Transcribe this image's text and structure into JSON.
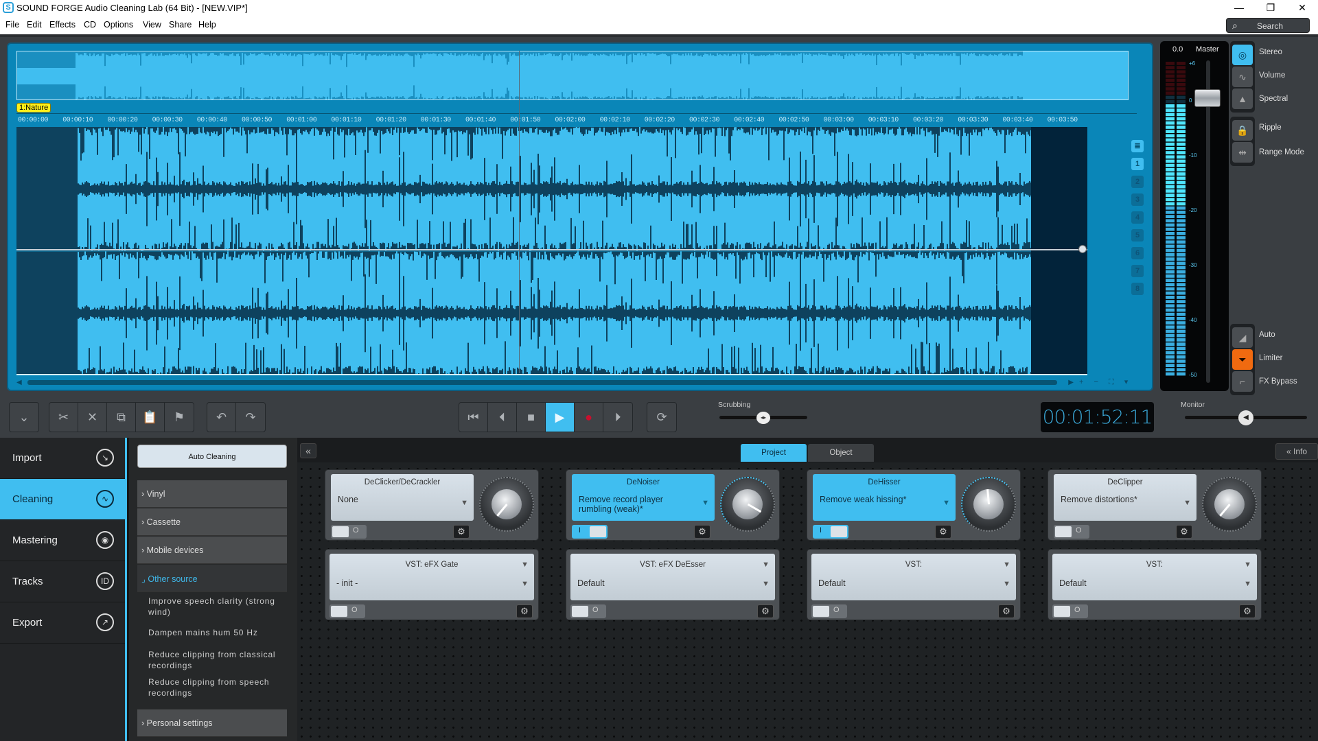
{
  "window": {
    "title": "SOUND FORGE Audio Cleaning Lab (64 Bit) - [NEW.VIP*]",
    "app_icon": "S",
    "minimize_glyph": "—",
    "restore_glyph": "❐",
    "close_glyph": "✕"
  },
  "menu": [
    "File",
    "Edit",
    "Effects",
    "CD",
    "Options",
    "View",
    "Share",
    "Help"
  ],
  "search": {
    "label": "Search",
    "icon": "magnifier-icon"
  },
  "waveform": {
    "marker_label": "1:Nature",
    "ruler_ticks": [
      "00:00:00",
      "00:00:10",
      "00:00:20",
      "00:00:30",
      "00:00:40",
      "00:00:50",
      "00:01:00",
      "00:01:10",
      "00:01:20",
      "00:01:30",
      "00:01:40",
      "00:01:50",
      "00:02:00",
      "00:02:10",
      "00:02:20",
      "00:02:30",
      "00:02:40",
      "00:02:50",
      "00:03:00",
      "00:03:10",
      "00:03:20",
      "00:03:30",
      "00:03:40",
      "00:03:50"
    ],
    "track_buttons": [
      "≣",
      "1",
      "2",
      "3",
      "4",
      "5",
      "6",
      "7",
      "8"
    ],
    "active_track": "1",
    "zoom_controls": [
      "+",
      "−",
      "⛶",
      "▾"
    ]
  },
  "meter": {
    "peak_value": "0.0",
    "label": "Master",
    "scale": [
      "+6",
      "0",
      "-10",
      "-20",
      "-30",
      "-40",
      "-50"
    ]
  },
  "view_modes": [
    {
      "label": "Stereo",
      "active": true,
      "icon": "stereo-icon",
      "glyph": "◎"
    },
    {
      "label": "Volume",
      "active": false,
      "icon": "volume-curve-icon",
      "glyph": "∿"
    },
    {
      "label": "Spectral",
      "active": false,
      "icon": "spectral-icon",
      "glyph": "▲"
    }
  ],
  "edit_modes": [
    {
      "label": "Ripple",
      "icon": "lock-icon",
      "glyph": "🔒"
    },
    {
      "label": "Range Mode",
      "icon": "range-mode-icon",
      "glyph": "⇹"
    }
  ],
  "dynamics": [
    {
      "label": "Auto",
      "icon": "auto-ramp-icon",
      "glyph": "◢",
      "state": "off"
    },
    {
      "label": "Limiter",
      "icon": "limiter-icon",
      "glyph": "⏷",
      "state": "orange"
    },
    {
      "label": "FX Bypass",
      "icon": "fx-bypass-icon",
      "glyph": "⌐",
      "state": "off"
    }
  ],
  "toolbar": {
    "collapse": "⌄",
    "edit_tools": [
      {
        "name": "cut",
        "glyph": "✂"
      },
      {
        "name": "delete",
        "glyph": "✕"
      },
      {
        "name": "copy",
        "glyph": "⧉"
      },
      {
        "name": "paste",
        "glyph": "📋"
      },
      {
        "name": "marker",
        "glyph": "⚑"
      }
    ],
    "history": [
      {
        "name": "undo",
        "glyph": "↶"
      },
      {
        "name": "redo",
        "glyph": "↷"
      }
    ]
  },
  "transport": {
    "buttons": [
      {
        "name": "go-to-start",
        "glyph": "⏮"
      },
      {
        "name": "previous",
        "glyph": "⏴"
      },
      {
        "name": "stop",
        "glyph": "■"
      },
      {
        "name": "play",
        "glyph": "▶"
      },
      {
        "name": "record",
        "glyph": "●"
      },
      {
        "name": "next",
        "glyph": "⏵"
      }
    ],
    "loop_glyph": "⟳",
    "scrubbing_label": "Scrubbing",
    "scrubbing_position": 0.5,
    "time": "00:01:52:11",
    "monitor_label": "Monitor",
    "monitor_level": 0.5
  },
  "nav": [
    {
      "label": "Import",
      "icon": "import-icon",
      "glyph": "↘",
      "active": false
    },
    {
      "label": "Cleaning",
      "icon": "cleaning-icon",
      "glyph": "∿",
      "active": true
    },
    {
      "label": "Mastering",
      "icon": "mastering-icon",
      "glyph": "◉",
      "active": false
    },
    {
      "label": "Tracks",
      "icon": "tracks-id-icon",
      "glyph": "ID",
      "active": false
    },
    {
      "label": "Export",
      "icon": "export-icon",
      "glyph": "↗",
      "active": false
    }
  ],
  "presets": {
    "auto_cleaning": "Auto Cleaning",
    "categories": [
      {
        "label": "Vinyl",
        "chevron": "›"
      },
      {
        "label": "Cassette",
        "chevron": "›"
      },
      {
        "label": "Mobile devices",
        "chevron": "›"
      }
    ],
    "open_category": {
      "label": "Other source",
      "chevron": "⌟"
    },
    "items": [
      "Improve speech clarity (strong wind)",
      "Dampen mains hum 50 Hz",
      "Reduce clipping from classical recordings",
      "Reduce clipping from speech recordings"
    ],
    "personal": {
      "label": "Personal settings",
      "chevron": "›"
    }
  },
  "fx_panel": {
    "collapse": "«",
    "tabs": [
      {
        "label": "Project",
        "active": true
      },
      {
        "label": "Object",
        "active": false
      }
    ],
    "info": "« Info",
    "modules": [
      {
        "name": "DeClicker/DeCrackler",
        "value": "None",
        "on": false,
        "knob_rotation": 40
      },
      {
        "name": "DeNoiser",
        "value": "Remove record player rumbling (weak)*",
        "on": true,
        "knob_rotation": -60
      },
      {
        "name": "DeHisser",
        "value": "Remove weak hissing*",
        "on": true,
        "knob_rotation": 175
      },
      {
        "name": "DeClipper",
        "value": "Remove distortions*",
        "on": false,
        "knob_rotation": 40
      }
    ],
    "vst": [
      {
        "name": "VST: eFX Gate",
        "value": "- init -"
      },
      {
        "name": "VST: eFX DeEsser",
        "value": "Default"
      },
      {
        "name": "VST:",
        "value": "Default"
      },
      {
        "name": "VST:",
        "value": "Default"
      }
    ],
    "toggle_off_glyph": "O",
    "toggle_on_glyph": "I",
    "gear_glyph": "⚙",
    "dropdown_glyph": "▼"
  },
  "colors": {
    "accent": "#40bef0",
    "wave_bg": "#40bef0",
    "wave_dark": "#02233a",
    "record": "#c8102e",
    "limiter": "#f06a10",
    "marker": "#ffef1a"
  }
}
